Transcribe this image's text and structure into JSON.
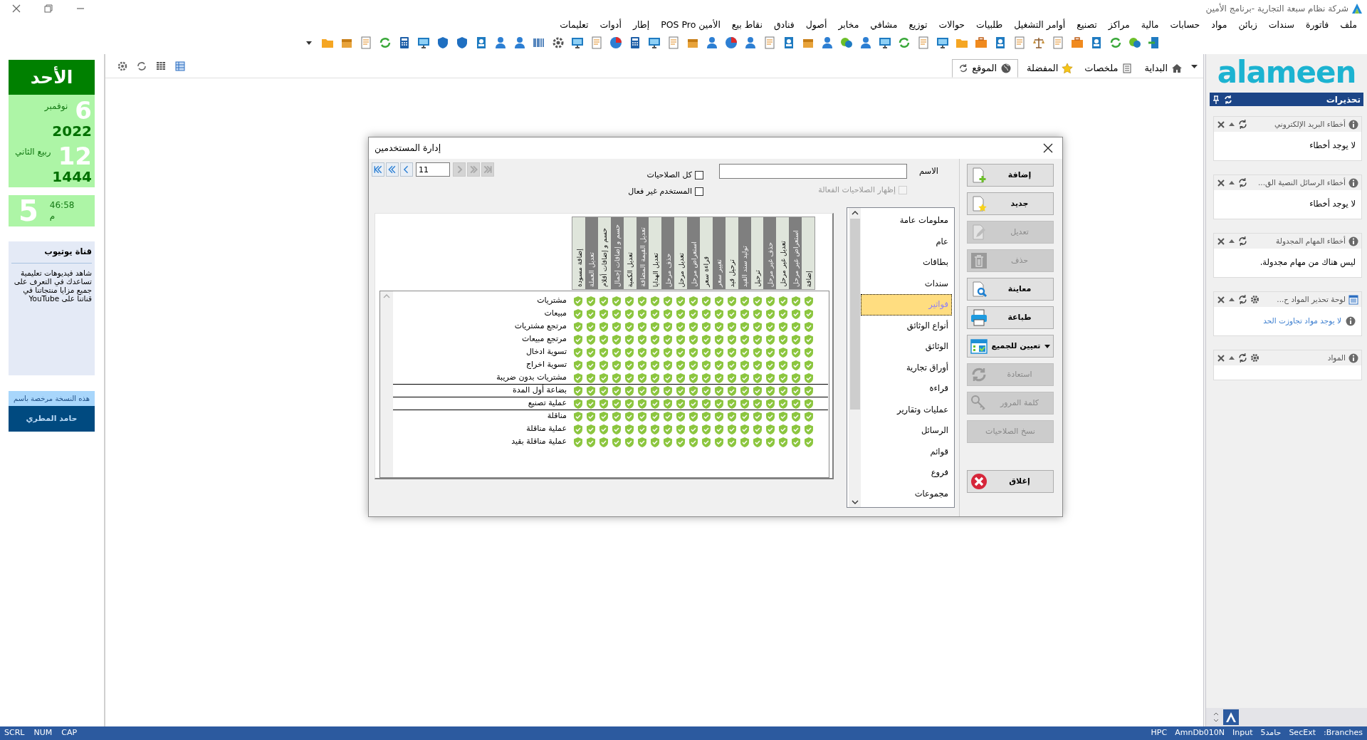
{
  "window": {
    "title": "شركة نظام سبعة التجارية -برنامج الأمين"
  },
  "menu": [
    "ملف",
    "فاتورة",
    "سندات",
    "زبائن",
    "مواد",
    "حسابات",
    "مالية",
    "مراكز",
    "تصنيع",
    "أوامر التشغيل",
    "طلبيات",
    "حوالات",
    "توزيع",
    "مشافي",
    "مخابر",
    "أصول",
    "فنادق",
    "نقاط بيع",
    "الأمين POS Pro",
    "إطار",
    "أدوات",
    "تعليمات"
  ],
  "tabs": [
    {
      "label": "البداية",
      "selected": false
    },
    {
      "label": "ملخصات",
      "selected": false
    },
    {
      "label": "المفضلة",
      "selected": false
    },
    {
      "label": "الموقع",
      "selected": true
    }
  ],
  "logo": "alameen",
  "calendar": {
    "day": "الأحد",
    "gregorian_day": "6",
    "gregorian_month": "نوفمبر",
    "gregorian_year": "2022",
    "hijri_day": "12",
    "hijri_month": "ربيع الثاني",
    "hijri_year": "1444",
    "clock_hour": "5",
    "clock_time": "46:58",
    "clock_period": "م"
  },
  "youtube": {
    "title": "قناة يوتيوب",
    "text": "شاهد فيديوهات تعليمية تساعدك في التعرف على جميع مزايا منتجاتنا في قناتنا على YouTube"
  },
  "license": {
    "caption": "هذه النسخة مرخصة باسم",
    "owner": "حامد المطري"
  },
  "warnings": {
    "title": "تحذيرات",
    "panels": [
      {
        "title": "أخطاء البريد الإلكتروني",
        "settings": false,
        "kind": "text",
        "body": "لا يوجد أخطاء"
      },
      {
        "title": "أخطاء الرسائل النصية الق...",
        "settings": false,
        "kind": "text",
        "body": "لا يوجد أخطاء"
      },
      {
        "title": "أخطاء المهام المجدولة",
        "settings": false,
        "kind": "text",
        "body": "ليس هناك من مهام مجدولة."
      },
      {
        "title": "لوحة تحذير المواد ح...",
        "settings": true,
        "kind": "link",
        "body": "لا يوجد مواد تجاوزت الحد"
      },
      {
        "title": "المواد",
        "settings": true,
        "kind": "empty"
      }
    ]
  },
  "dialog": {
    "title": "إدارة المستخدمين",
    "name_label": "الاسم",
    "checkboxes": [
      {
        "label": "كل الصلاحيات",
        "checked": false,
        "disabled": false
      },
      {
        "label": "إظهار الصلاحيات الفعالة",
        "checked": false,
        "disabled": true
      },
      {
        "label": "المستخدم غير فعال",
        "checked": false,
        "disabled": false
      }
    ],
    "pager": {
      "value": "11",
      "buttons": [
        {
          "disabled": false
        },
        {
          "disabled": false
        },
        {
          "disabled": false
        },
        {
          "disabled": true
        },
        {
          "disabled": true
        },
        {
          "disabled": true
        }
      ]
    },
    "columns": [
      "إضافة",
      "استعراض غير مرحل",
      "تعديل غير مرحل",
      "حذف غير مرحل",
      "ترحيل",
      "توليد سند القيد",
      "ترحيل قيد",
      "تغيير سعر",
      "قراءة سعر",
      "استعراض مرحل",
      "تعديل مرحل",
      "حذف مرحل",
      "تعديل الهدايا",
      "تعديل القيمة المضافة",
      "تعديل الكمية",
      "حسم و إضافات إجمال",
      "حسم و إضافات أقلام",
      "تعديل العملة",
      "إضافة مسودة"
    ],
    "rows": [
      {
        "label": "مشتريات",
        "granted": true,
        "outlined": false
      },
      {
        "label": "مبيعات",
        "granted": true,
        "outlined": false
      },
      {
        "label": "مرتجع مشتريات",
        "granted": true,
        "outlined": false
      },
      {
        "label": "مرتجع مبيعات",
        "granted": true,
        "outlined": false
      },
      {
        "label": "تسوية ادخال",
        "granted": true,
        "outlined": false
      },
      {
        "label": "تسوية اخراج",
        "granted": true,
        "outlined": false
      },
      {
        "label": "مشتريات بدون ضريبة",
        "granted": true,
        "outlined": false
      },
      {
        "label": "بضاعة أول المدة",
        "granted": true,
        "outlined": true
      },
      {
        "label": "عملية تصنيع",
        "granted": true,
        "outlined": true
      },
      {
        "label": "مناقلة",
        "granted": true,
        "outlined": false
      },
      {
        "label": "عملية مناقلة",
        "granted": true,
        "outlined": false
      },
      {
        "label": "عملية مناقلة بقيد",
        "granted": true,
        "outlined": false
      }
    ],
    "sections": [
      {
        "label": "معلومات عامة",
        "selected": false
      },
      {
        "label": "عام",
        "selected": false
      },
      {
        "label": "بطاقات",
        "selected": false
      },
      {
        "label": "سندات",
        "selected": false
      },
      {
        "label": "فواتير",
        "selected": true
      },
      {
        "label": "أنواع الوثائق",
        "selected": false
      },
      {
        "label": "الوثائق",
        "selected": false
      },
      {
        "label": "أوراق تجارية",
        "selected": false
      },
      {
        "label": "قراءة",
        "selected": false
      },
      {
        "label": "عمليات وتقارير",
        "selected": false
      },
      {
        "label": "الرسائل",
        "selected": false
      },
      {
        "label": "قوائم",
        "selected": false
      },
      {
        "label": "فروع",
        "selected": false
      },
      {
        "label": "مجموعات",
        "selected": false
      }
    ],
    "buttons": [
      {
        "label": "إضافة",
        "kind": "add",
        "disabled": false
      },
      {
        "label": "جديد",
        "kind": "new",
        "disabled": false
      },
      {
        "label": "تعديل",
        "kind": "edit",
        "disabled": true
      },
      {
        "label": "حذف",
        "kind": "delete",
        "disabled": true
      },
      {
        "label": "معاينة",
        "kind": "preview",
        "disabled": false
      },
      {
        "label": "طباعة",
        "kind": "print",
        "disabled": false
      },
      {
        "label": "تعيين للجميع",
        "kind": "assign",
        "disabled": false
      },
      {
        "label": "استعادة",
        "kind": "restore",
        "disabled": true
      },
      {
        "label": "كلمة المرور",
        "kind": "password",
        "disabled": true
      },
      {
        "label": "نسخ الصلاحيات",
        "kind": "plain",
        "disabled": true
      },
      {
        "label": "إغلاق",
        "kind": "close",
        "disabled": false
      }
    ]
  },
  "status_bar": {
    "left": [
      "CAP",
      "NUM",
      "SCRL"
    ],
    "right": [
      "Branches:",
      "SecExt",
      "حامد5",
      "Input",
      "AmnDb010N",
      "HPC"
    ]
  }
}
